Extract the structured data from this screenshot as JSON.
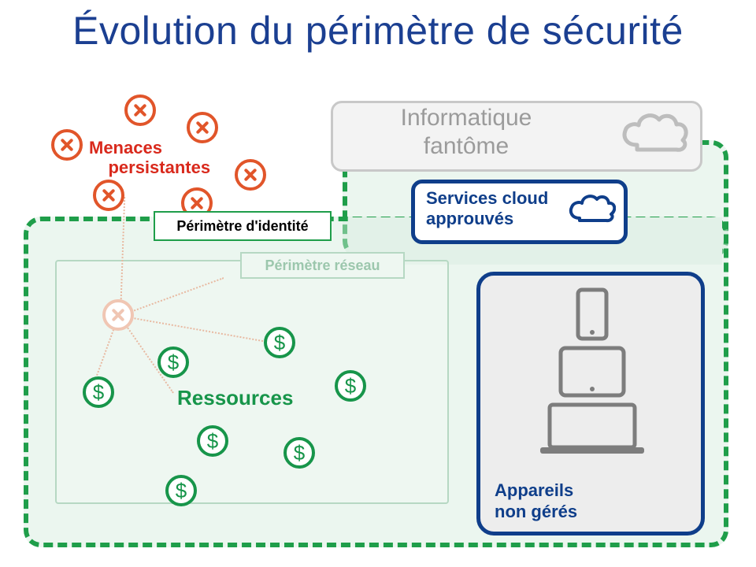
{
  "title": "Évolution du périmètre de sécurité",
  "threats": {
    "label_line1": "Menaces",
    "label_line2": "persistantes"
  },
  "identity_perimeter_label": "Périmètre d'identité",
  "network_perimeter_label": "Périmètre réseau",
  "resources_label": "Ressources",
  "shadow_it": {
    "line1": "Informatique",
    "line2": "fantôme"
  },
  "approved_cloud": {
    "line1": "Services cloud",
    "line2": "approuvés"
  },
  "devices": {
    "line1": "Appareils",
    "line2": "non gérés"
  },
  "colors": {
    "title": "#1b3f91",
    "green": "#1f9e4a",
    "green_text": "#17954a",
    "orange": "#e1552a",
    "red_text": "#d9291c",
    "navy": "#0f3e8a",
    "grey": "#9b9b9b"
  },
  "dollar_glyph": "$"
}
